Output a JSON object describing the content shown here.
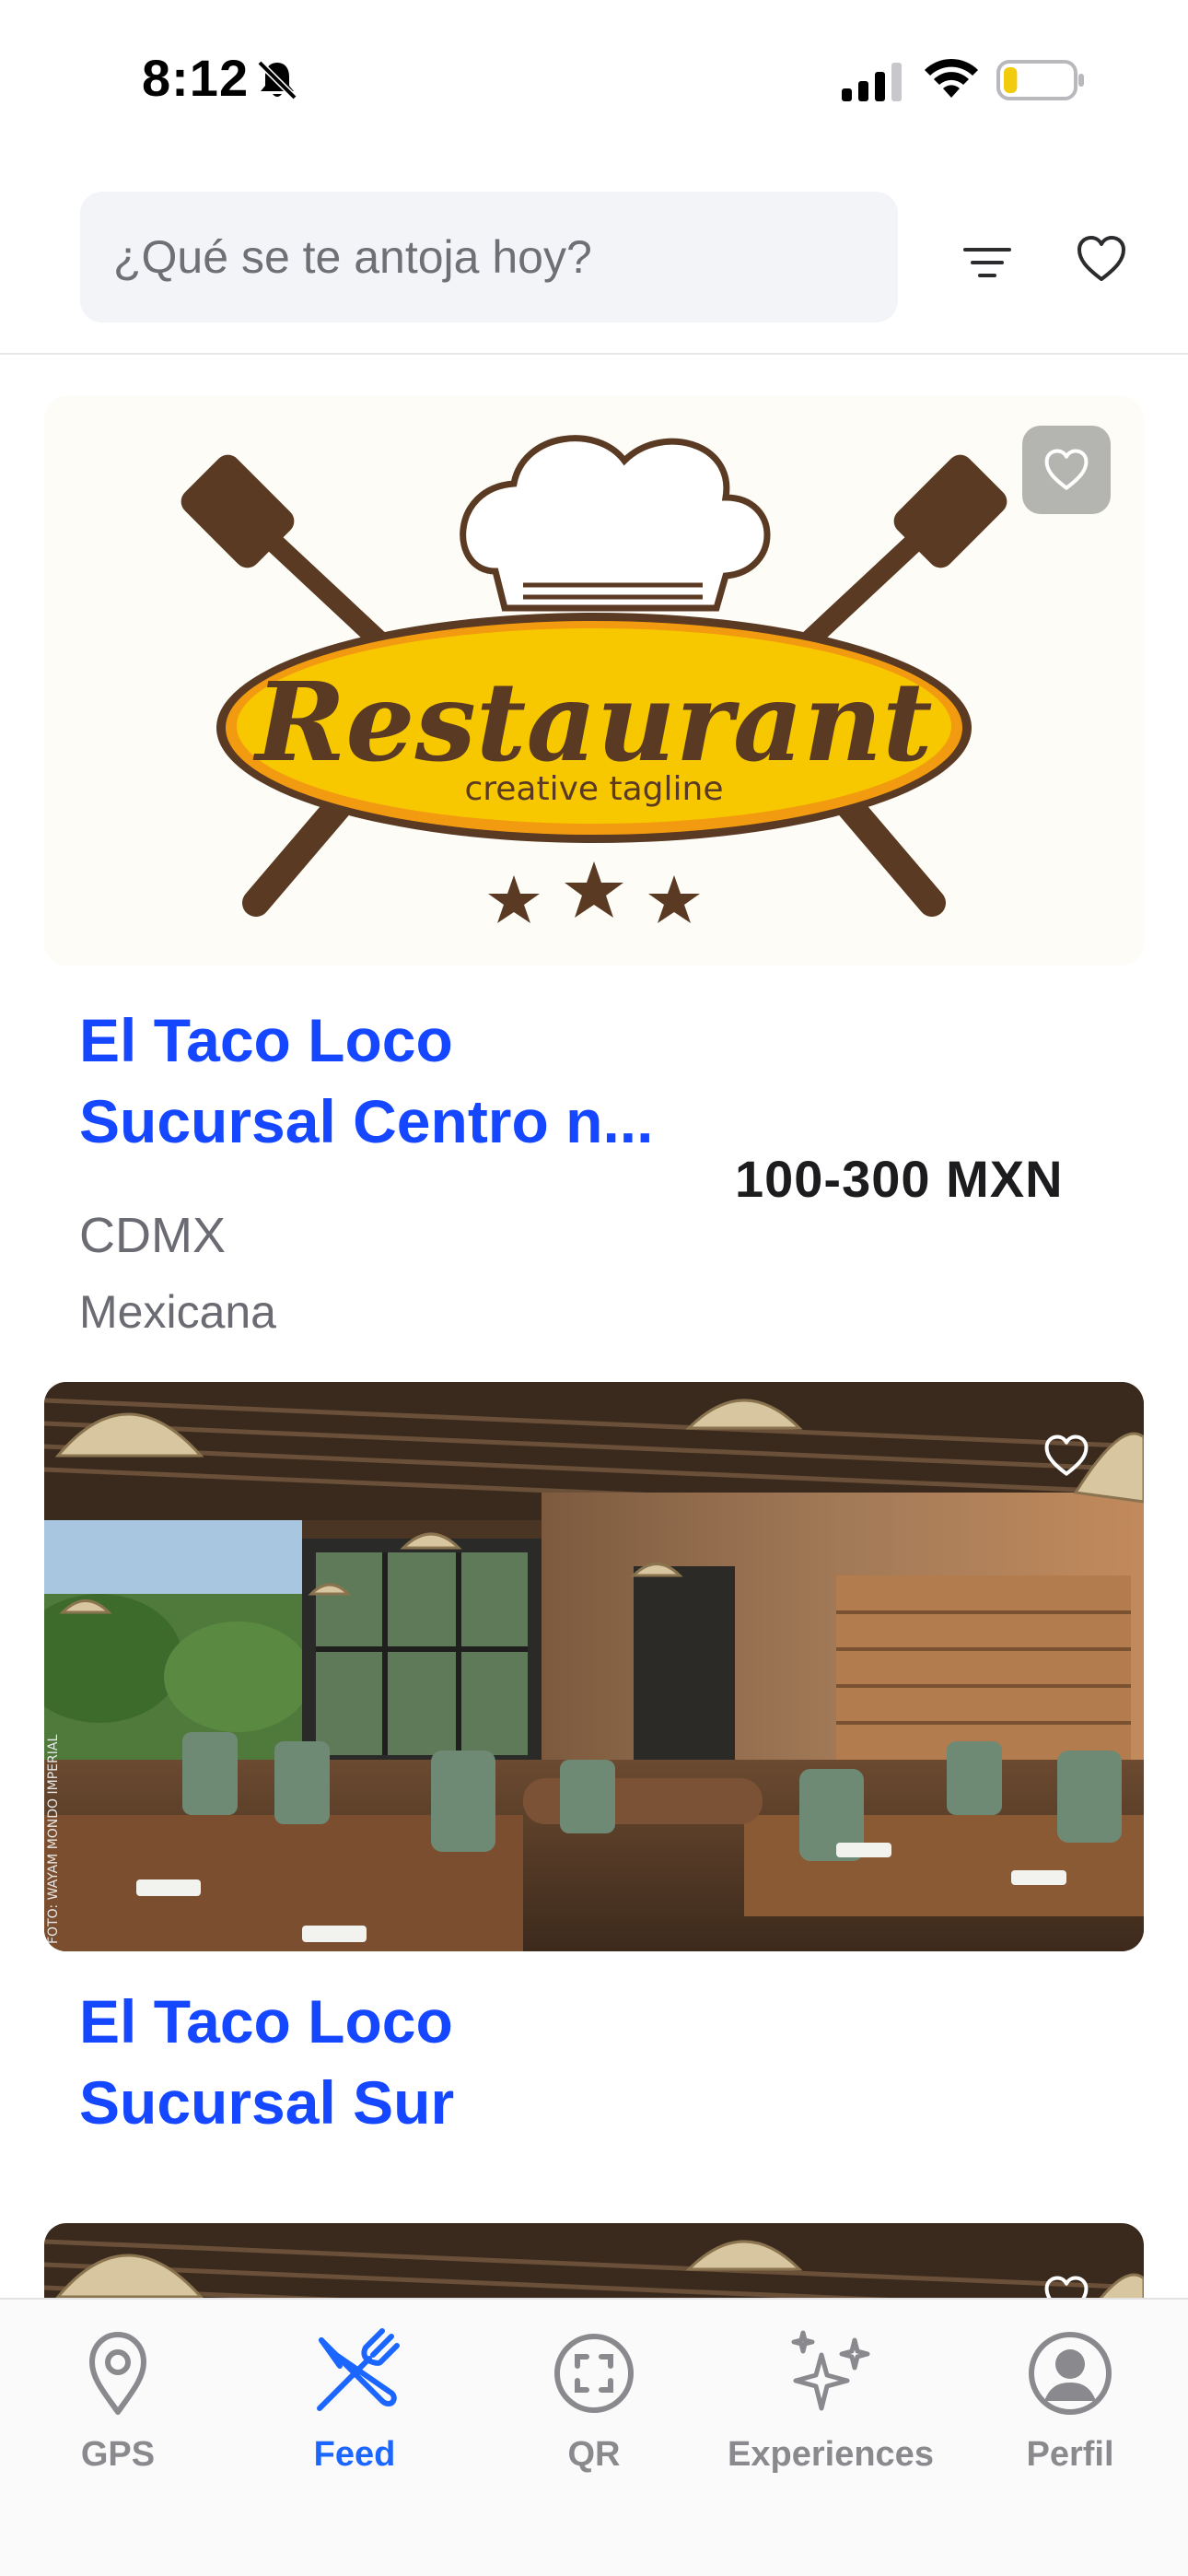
{
  "status_bar": {
    "time": "8:12",
    "icons": [
      "bell-slash-icon",
      "signal-icon",
      "wifi-icon",
      "battery-icon"
    ],
    "battery_level": 0.2
  },
  "search": {
    "placeholder": "¿Qué se te antoja hoy?",
    "icons": [
      "filter-icon",
      "heart-icon"
    ]
  },
  "feed": {
    "cards": [
      {
        "logo": {
          "word": "Restaurant",
          "tagline": "creative tagline"
        },
        "favorite": false,
        "name_line1": "El Taco Loco",
        "name_line2": "Sucursal Centro n...",
        "price_range": "100-300 MXN",
        "city": "CDMX",
        "cuisine": "Mexicana"
      },
      {
        "photo_credit": "FOTO: WAYAM MONDO IMPERIAL",
        "favorite": false,
        "name_line1": "El Taco Loco",
        "name_line2": "Sucursal Sur"
      },
      {
        "favorite": false
      }
    ]
  },
  "bottom_nav": {
    "items": [
      {
        "label": "GPS",
        "icon": "location-pin-icon",
        "active": false
      },
      {
        "label": "Feed",
        "icon": "fork-knife-icon",
        "active": true
      },
      {
        "label": "QR",
        "icon": "qr-scan-icon",
        "active": false
      },
      {
        "label": "Experiences",
        "icon": "sparkles-icon",
        "active": false
      },
      {
        "label": "Perfil",
        "icon": "profile-icon",
        "active": false
      }
    ]
  },
  "colors": {
    "accent": "#1447ff",
    "nav_active": "#1b66ff",
    "nav_inactive": "#8a8a8e",
    "logo_yellow": "#f7c800",
    "logo_brown": "#5a3a22"
  }
}
